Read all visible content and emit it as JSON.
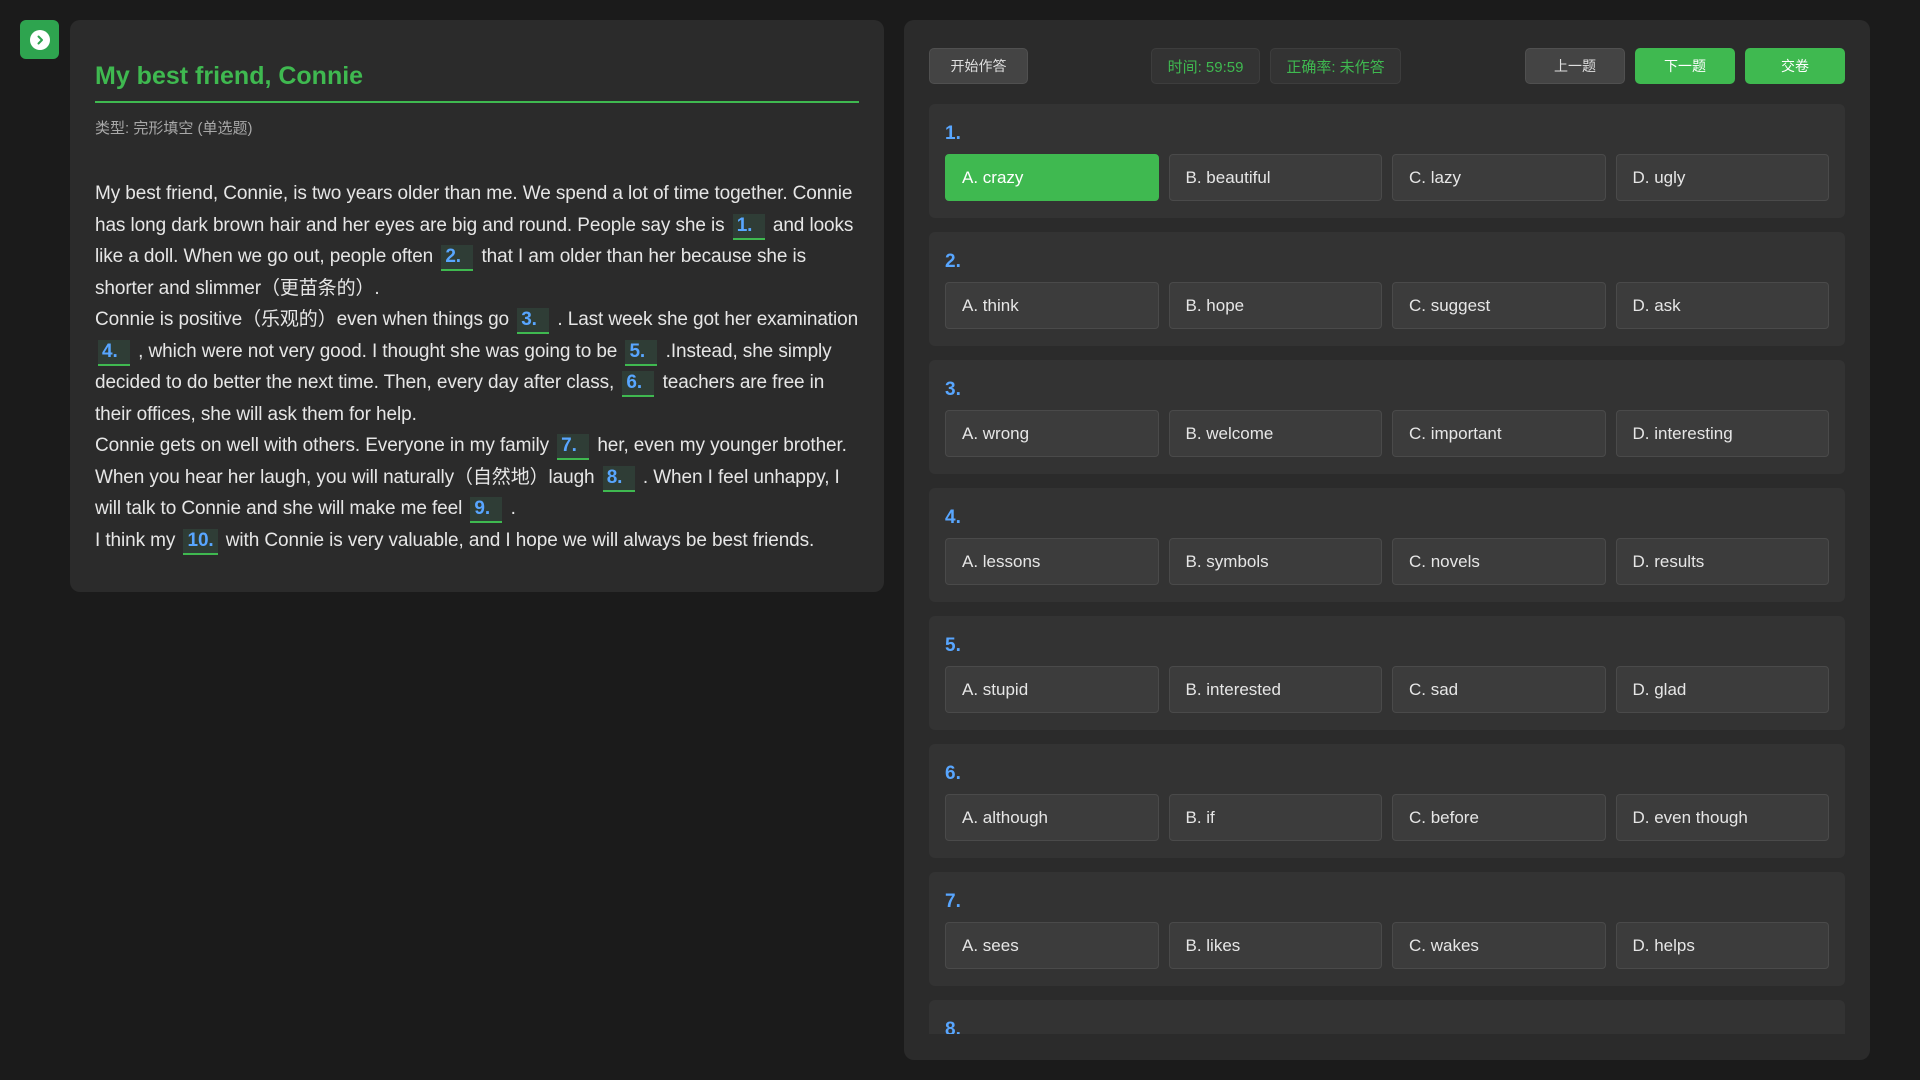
{
  "passage": {
    "title": "My best friend, Connie",
    "type_label": "类型: 完形填空 (单选题)",
    "segments": [
      {
        "t": "My best friend, Connie, is two years older than me. We spend a lot of time together. Connie has long dark brown hair and her eyes are big and round. People say she is "
      },
      {
        "b": "1."
      },
      {
        "t": " and looks like a doll. When we go out, people often "
      },
      {
        "b": "2."
      },
      {
        "t": " that I am older than her because she is shorter and slimmer（更苗条的）."
      },
      {
        "br": true
      },
      {
        "t": "Connie is positive（乐观的）even when things go "
      },
      {
        "b": "3."
      },
      {
        "t": " . Last week she got her examination "
      },
      {
        "b": "4."
      },
      {
        "t": " , which were not very good. I thought she was going to be "
      },
      {
        "b": "5."
      },
      {
        "t": " .Instead, she simply decided to do better the next time. Then, every day after class, "
      },
      {
        "b": "6."
      },
      {
        "t": " teachers are free in their offices, she will ask them for help."
      },
      {
        "br": true
      },
      {
        "t": "Connie gets on well with others. Everyone in my family "
      },
      {
        "b": "7."
      },
      {
        "t": " her, even my younger brother. When you hear her laugh, you will naturally（自然地）laugh "
      },
      {
        "b": "8."
      },
      {
        "t": " . When I feel unhappy, I will talk to Connie and she will make me feel "
      },
      {
        "b": "9."
      },
      {
        "t": " ."
      },
      {
        "br": true
      },
      {
        "t": "I think my "
      },
      {
        "b": "10."
      },
      {
        "t": " with Connie is very valuable, and I hope we will always be best friends."
      }
    ]
  },
  "toolbar": {
    "start_label": "开始作答",
    "timer_text": "时间: 59:59",
    "accuracy_text": "正确率: 未作答",
    "prev_label": "上一题",
    "next_label": "下一题",
    "submit_label": "交卷"
  },
  "questions": [
    {
      "num": "1.",
      "selected": 0,
      "options": [
        "A. crazy",
        "B. beautiful",
        "C. lazy",
        "D. ugly"
      ]
    },
    {
      "num": "2.",
      "selected": -1,
      "options": [
        "A. think",
        "B. hope",
        "C. suggest",
        "D. ask"
      ]
    },
    {
      "num": "3.",
      "selected": -1,
      "options": [
        "A. wrong",
        "B. welcome",
        "C. important",
        "D. interesting"
      ]
    },
    {
      "num": "4.",
      "selected": -1,
      "options": [
        "A. lessons",
        "B. symbols",
        "C. novels",
        "D. results"
      ]
    },
    {
      "num": "5.",
      "selected": -1,
      "options": [
        "A. stupid",
        "B. interested",
        "C. sad",
        "D. glad"
      ]
    },
    {
      "num": "6.",
      "selected": -1,
      "options": [
        "A. although",
        "B. if",
        "C. before",
        "D. even though"
      ]
    },
    {
      "num": "7.",
      "selected": -1,
      "options": [
        "A. sees",
        "B. likes",
        "C. wakes",
        "D. helps"
      ]
    },
    {
      "num": "8.",
      "selected": -1,
      "options": []
    }
  ],
  "colors": {
    "accent": "#3fb950",
    "blank_text": "#58a6ff",
    "background": "#1b1b1b",
    "panel": "#2b2b2b"
  },
  "icons": {
    "toggle": "chevron-right-circle-icon"
  }
}
